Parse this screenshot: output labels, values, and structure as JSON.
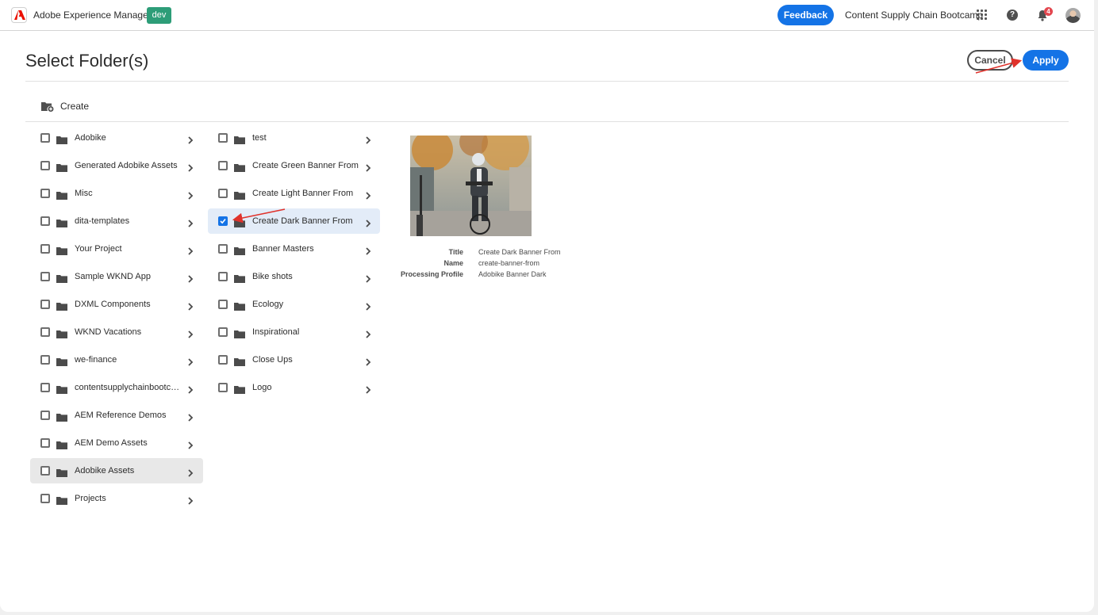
{
  "header": {
    "app_name": "Adobe Experience Manager",
    "env_badge": "dev",
    "feedback_label": "Feedback",
    "org_name": "Content Supply Chain Bootcamp",
    "notification_count": "4",
    "help_glyph": "?",
    "icons": [
      "adobe-logo-icon",
      "apps-grid-icon",
      "help-icon",
      "bell-icon",
      "avatar"
    ]
  },
  "page": {
    "title": "Select Folder(s)",
    "cancel_label": "Cancel",
    "apply_label": "Apply",
    "create_label": "Create"
  },
  "column1": {
    "items": [
      {
        "label": "Adobike",
        "checked": false
      },
      {
        "label": "Generated Adobike Assets",
        "checked": false
      },
      {
        "label": "Misc",
        "checked": false
      },
      {
        "label": "dita-templates",
        "checked": false
      },
      {
        "label": "Your Project",
        "checked": false
      },
      {
        "label": "Sample WKND App",
        "checked": false
      },
      {
        "label": "DXML Components",
        "checked": false
      },
      {
        "label": "WKND Vacations",
        "checked": false
      },
      {
        "label": "we-finance",
        "checked": false
      },
      {
        "label": "contentsupplychainbootcam...",
        "checked": false
      },
      {
        "label": "AEM Reference Demos",
        "checked": false
      },
      {
        "label": "AEM Demo Assets",
        "checked": false
      },
      {
        "label": "Adobike Assets",
        "checked": false,
        "highlighted": true
      },
      {
        "label": "Projects",
        "checked": false
      }
    ]
  },
  "column2": {
    "items": [
      {
        "label": "test",
        "checked": false
      },
      {
        "label": "Create Green Banner From",
        "checked": false
      },
      {
        "label": "Create Light Banner From",
        "checked": false
      },
      {
        "label": "Create Dark Banner From",
        "checked": true,
        "selected": true
      },
      {
        "label": "Banner Masters",
        "checked": false
      },
      {
        "label": "Bike shots",
        "checked": false
      },
      {
        "label": "Ecology",
        "checked": false
      },
      {
        "label": "Inspirational",
        "checked": false
      },
      {
        "label": "Close Ups",
        "checked": false
      },
      {
        "label": "Logo",
        "checked": false
      }
    ]
  },
  "preview": {
    "meta": [
      {
        "key": "Title",
        "value": "Create Dark Banner From"
      },
      {
        "key": "Name",
        "value": "create-banner-from"
      },
      {
        "key": "Processing Profile",
        "value": "Adobike Banner Dark"
      }
    ]
  },
  "colors": {
    "accent": "#1473e6",
    "env_badge": "#2d9d78",
    "annotation_arrow": "#e0322b",
    "notification_badge": "#e34850"
  }
}
